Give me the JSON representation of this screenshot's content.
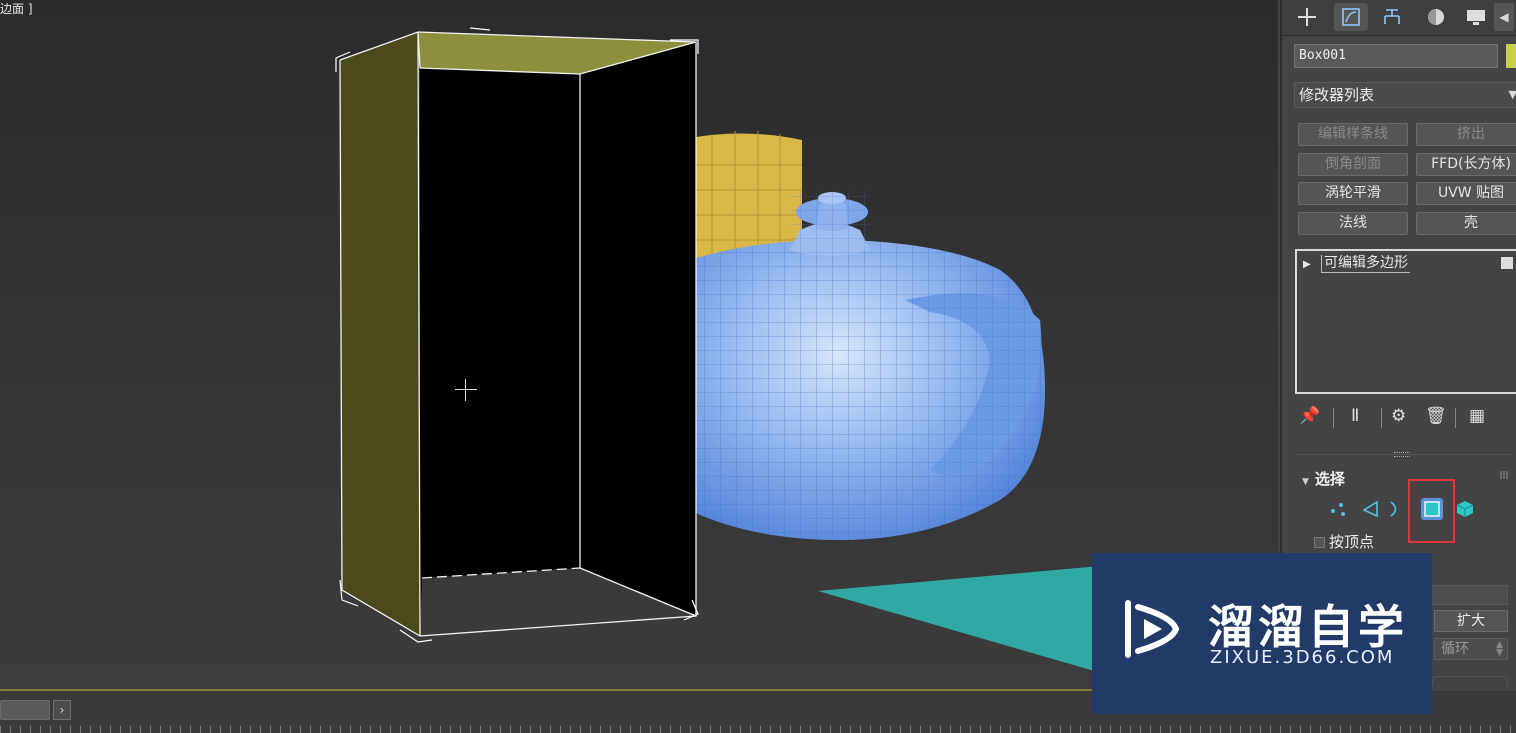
{
  "viewport": {
    "label": "边面 ]"
  },
  "panel": {
    "tabs": [
      "create-tab",
      "modify-tab",
      "hierarchy-tab",
      "motion-tab",
      "display-tab"
    ],
    "object_name": "Box001",
    "object_color": "#c7d24a",
    "modifier_list_label": "修改器列表",
    "modifier_buttons": [
      {
        "label": "编辑样条线",
        "enabled": false
      },
      {
        "label": "挤出",
        "enabled": false
      },
      {
        "label": "倒角剖面",
        "enabled": false
      },
      {
        "label": "FFD(长方体)",
        "enabled": true
      },
      {
        "label": "涡轮平滑",
        "enabled": true
      },
      {
        "label": "UVW 贴图",
        "enabled": true
      },
      {
        "label": "法线",
        "enabled": true
      },
      {
        "label": "壳",
        "enabled": true
      }
    ],
    "stack_items": [
      {
        "label": "可编辑多边形"
      }
    ],
    "selection_rollout": {
      "title": "选择",
      "by_vertex_label": "按顶点",
      "grow_label": "扩大",
      "loop_label": "循环"
    }
  },
  "watermark": {
    "title": "溜溜自学",
    "url": "ZIXUE.3D66.COM"
  },
  "colors": {
    "accent_blue": "#5b91d6",
    "highlight_red": "#e0353a",
    "watermark_bg": "#213a68"
  }
}
